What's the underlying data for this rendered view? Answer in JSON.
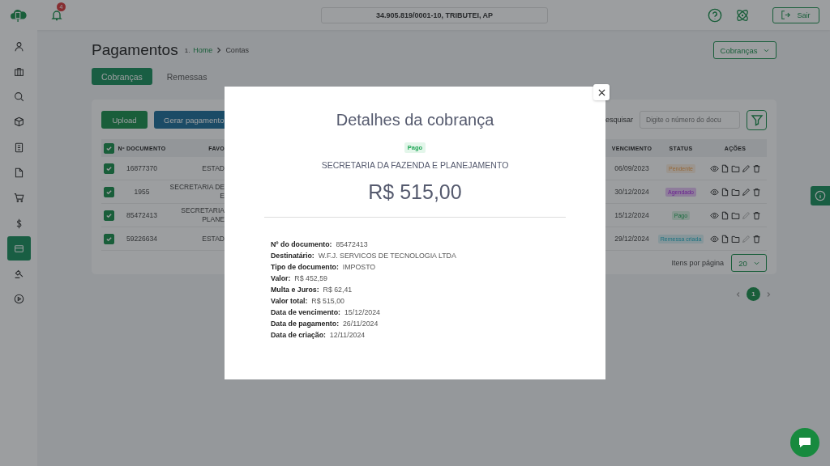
{
  "topbar": {
    "notifications": "4",
    "company": "34.905.819/0001-10, TRIBUTEI, AP",
    "logout": "Sair"
  },
  "sidebar": {
    "items": [
      {
        "selected": false
      },
      {
        "selected": false
      },
      {
        "selected": false
      },
      {
        "selected": false
      },
      {
        "selected": false
      },
      {
        "selected": false
      },
      {
        "selected": false
      },
      {
        "selected": false
      },
      {
        "selected": true
      },
      {
        "selected": false
      },
      {
        "selected": false
      }
    ]
  },
  "page": {
    "title": "Pagamentos",
    "breadcrumb_prefix": "1.",
    "breadcrumb": [
      "Home",
      "Contas"
    ],
    "dropdown": "Cobranças"
  },
  "tabs": [
    {
      "label": "Cobranças",
      "selected": true
    },
    {
      "label": "Remessas",
      "selected": false
    }
  ],
  "toolbar": {
    "buttons": [
      "Upload",
      "Gerar pagamento"
    ],
    "search_label": "esquisar",
    "search_placeholder": "Digite o número do docu"
  },
  "table": {
    "header_checked": true,
    "columns": [
      "Nº DOCUMENTO",
      "FAVO",
      "VENCIMENTO",
      "STATUS",
      "AÇÕES"
    ],
    "rows": [
      {
        "checked": true,
        "document": "16877370",
        "payee": [
          "ESTAD"
        ],
        "due": "06/09/2023",
        "status": {
          "label": "Pendente",
          "kind": "pending"
        },
        "edit_enabled": true
      },
      {
        "checked": true,
        "document": "1955",
        "payee": [
          "SECRETARIA DE E"
        ],
        "due": "30/12/2024",
        "status": {
          "label": "Agendado",
          "kind": "scheduled"
        },
        "edit_enabled": true
      },
      {
        "checked": true,
        "document": "85472413",
        "payee": [
          "SECRETARIA",
          "PLANE"
        ],
        "due": "15/12/2024",
        "status": {
          "label": "Pago",
          "kind": "paid"
        },
        "edit_enabled": false
      },
      {
        "checked": true,
        "document": "59226634",
        "payee": [
          "ESTAD"
        ],
        "due": "29/12/2024",
        "status": {
          "label": "Remessa criada",
          "kind": "remittance"
        },
        "edit_enabled": false
      }
    ]
  },
  "per_page": {
    "label": "Itens por página",
    "value": "20"
  },
  "pagination": [
    {
      "label": "1",
      "selected": true
    }
  ],
  "modal": {
    "title": "Detalhes da cobrança",
    "status": "Pago",
    "payee": "SECRETARIA DA FAZENDA E PLANEJAMENTO",
    "amount": "R$ 515,00",
    "details": [
      {
        "label": "Nº do documento:",
        "value": "85472413"
      },
      {
        "label": "Destinatário:",
        "value": "W.F.J. SERVICOS DE TECNOLOGIA LTDA"
      },
      {
        "label": "Tipo de documento:",
        "value": "IMPOSTO"
      },
      {
        "label": "Valor:",
        "value": "R$ 452,59"
      },
      {
        "label": "Multa e Juros:",
        "value": "R$ 62,41"
      },
      {
        "label": "Valor total:",
        "value": "R$ 515,00"
      },
      {
        "label": "Data de vencimento:",
        "value": "15/12/2024"
      },
      {
        "label": "Data de pagamento:",
        "value": "26/11/2024"
      },
      {
        "label": "Data de criação:",
        "value": "12/11/2024"
      }
    ]
  }
}
